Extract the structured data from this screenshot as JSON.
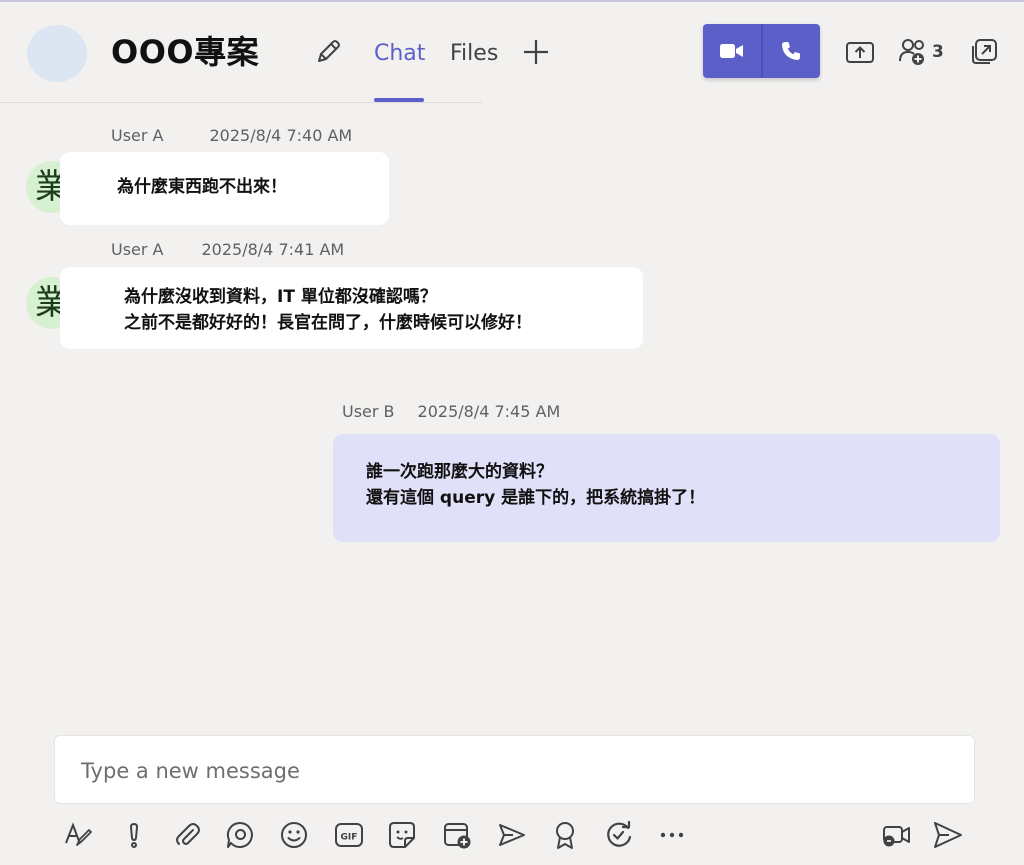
{
  "header": {
    "title": "OOO專案",
    "tabs": [
      {
        "label": "Chat",
        "active": true
      },
      {
        "label": "Files",
        "active": false
      }
    ],
    "participants_count": "3",
    "accent_color": "#5b5fc7"
  },
  "messages": [
    {
      "sender": "User A",
      "time": "2025/8/4 7:40 AM",
      "avatar_text": "業",
      "lines": [
        "為什麼東西跑不出來！"
      ],
      "mine": false
    },
    {
      "sender": "User A",
      "time": "2025/8/4 7:41 AM",
      "avatar_text": "業",
      "lines": [
        "為什麼沒收到資料，IT 單位都沒確認嗎？",
        "之前不是都好好的！長官在問了，什麼時候可以修好！"
      ],
      "mine": false
    },
    {
      "sender": "User B",
      "time": "2025/8/4 7:45 AM",
      "lines": [
        "誰一次跑那麼大的資料？",
        "還有這個 query 是誰下的，把系統搞掛了！"
      ],
      "mine": true
    }
  ],
  "compose": {
    "placeholder": "Type a new message"
  },
  "toolbar_icons": [
    "format-icon",
    "important-icon",
    "attach-icon",
    "loop-icon",
    "emoji-icon",
    "gif-icon",
    "sticker-icon",
    "schedule-meeting-icon",
    "send-praise-icon",
    "praise-icon",
    "updates-icon",
    "more-icon",
    "video-clip-icon",
    "send-icon"
  ]
}
